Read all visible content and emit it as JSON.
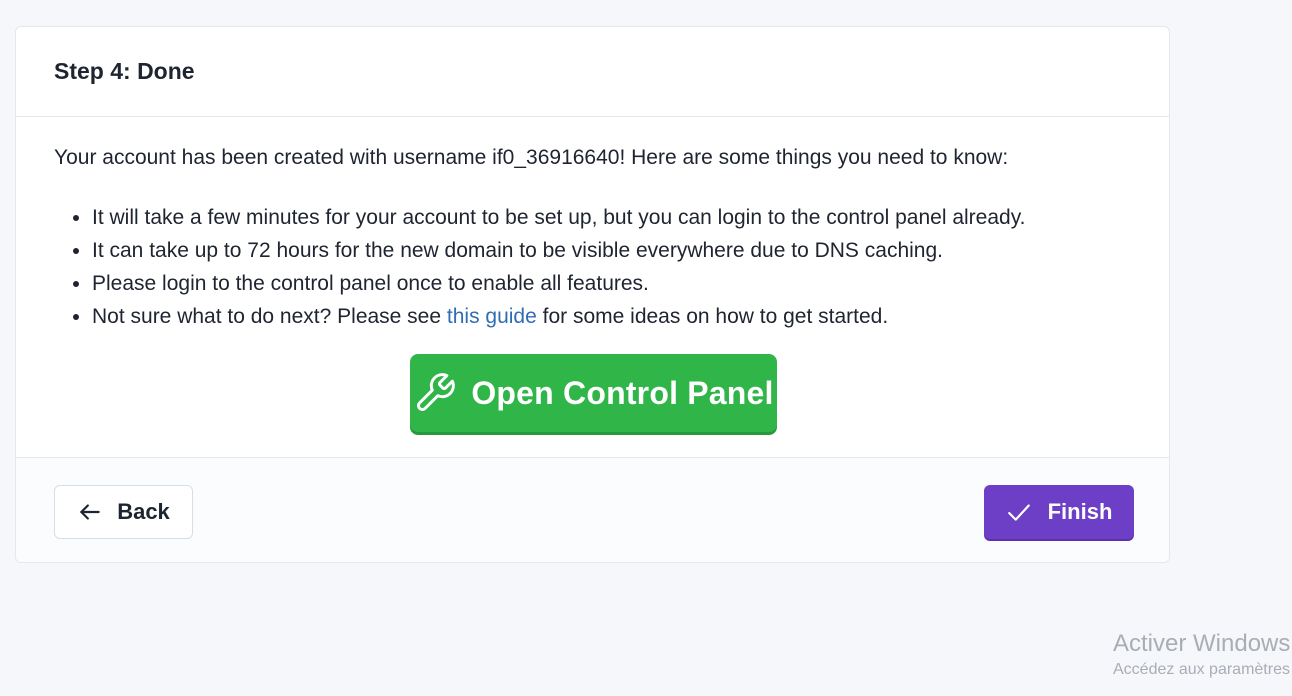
{
  "card": {
    "title": "Step 4: Done",
    "intro": "Your account has been created with username if0_36916640! Here are some things you need to know:",
    "bullets": [
      "It will take a few minutes for your account to be set up, but you can login to the control panel already.",
      "It can take up to 72 hours for the new domain to be visible everywhere due to DNS caching.",
      "Please login to the control panel once to enable all features."
    ],
    "guide_bullet": {
      "prefix": "Not sure what to do next? Please see ",
      "link_text": "this guide",
      "suffix": " for some ideas on how to get started."
    },
    "control_panel_button": {
      "label": "Open Control Panel",
      "icon": "wrench-icon",
      "color": "#2fb548"
    }
  },
  "footer": {
    "back_button": {
      "label": "Back",
      "icon": "arrow-left-icon"
    },
    "finish_button": {
      "label": "Finish",
      "icon": "checkmark-icon",
      "color": "#6c3fc6"
    }
  },
  "watermark": {
    "line1": "Activer Windows",
    "line2": "Accédez aux paramètres"
  }
}
